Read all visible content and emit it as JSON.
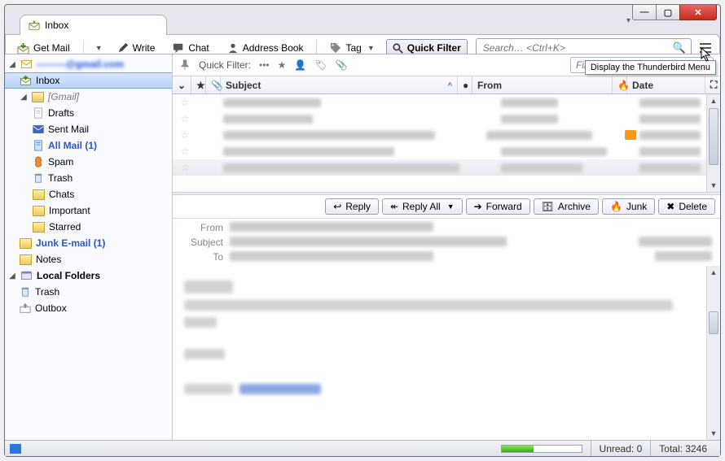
{
  "window_controls": {
    "min": "—",
    "max": "▢",
    "close": "✕"
  },
  "tabstrip": {
    "active_tab_label": "Inbox"
  },
  "toolbar": {
    "get_mail": "Get Mail",
    "write": "Write",
    "chat": "Chat",
    "address_book": "Address Book",
    "tag": "Tag",
    "quick_filter": "Quick Filter",
    "search_placeholder": "Search… <Ctrl+K>"
  },
  "menu_tooltip": "Display the Thunderbird Menu",
  "sidebar": {
    "account1": {
      "label": "———@gmail.com"
    },
    "items": [
      {
        "label": "Inbox",
        "selected": true
      },
      {
        "label": "[Gmail]",
        "gray": true
      },
      {
        "label": "Drafts"
      },
      {
        "label": "Sent Mail"
      },
      {
        "label": "All Mail (1)",
        "bold": true
      },
      {
        "label": "Spam"
      },
      {
        "label": "Trash"
      },
      {
        "label": "Chats"
      },
      {
        "label": "Important"
      },
      {
        "label": "Starred"
      },
      {
        "label": "Junk E-mail (1)",
        "bold": true
      },
      {
        "label": "Notes"
      }
    ],
    "account2": {
      "label": "Local Folders"
    },
    "local_items": [
      {
        "label": "Trash"
      },
      {
        "label": "Outbox"
      }
    ]
  },
  "quickfilter": {
    "label": "Quick Filter:",
    "filter_placeholder": "Filter these messages… <Ctrl"
  },
  "columns": {
    "subject": "Subject",
    "from": "From",
    "date": "Date"
  },
  "preview_toolbar": {
    "reply": "Reply",
    "reply_all": "Reply All",
    "forward": "Forward",
    "archive": "Archive",
    "junk": "Junk",
    "delete": "Delete"
  },
  "headers": {
    "from": "From",
    "subject": "Subject",
    "to": "To"
  },
  "statusbar": {
    "unread_label": "Unread:",
    "unread_value": "0",
    "total_label": "Total:",
    "total_value": "3246"
  }
}
